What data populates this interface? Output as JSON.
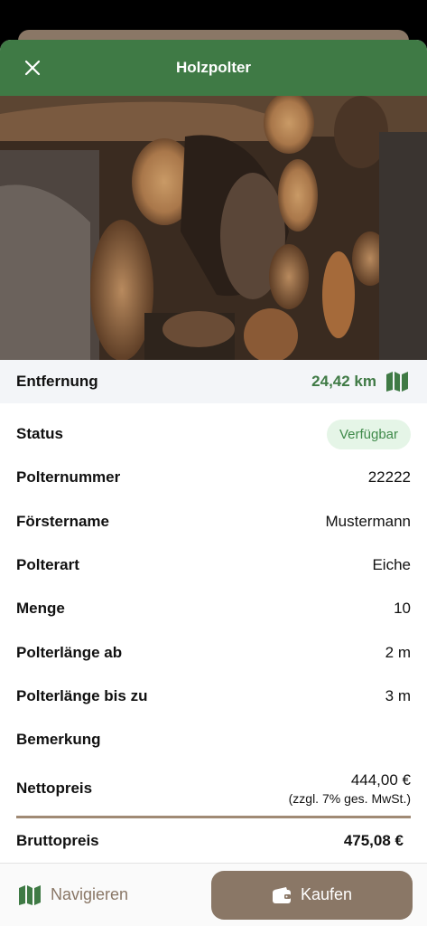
{
  "header": {
    "title": "Holzpolter",
    "close_icon": "close-icon"
  },
  "distance": {
    "label": "Entfernung",
    "value": "24,42 km",
    "icon": "map-icon",
    "color": "#3f7a45"
  },
  "details": [
    {
      "label": "Status",
      "value": "Verfügbar",
      "type": "badge"
    },
    {
      "label": "Polternummer",
      "value": "22222"
    },
    {
      "label": "Förstername",
      "value": "Mustermann"
    },
    {
      "label": "Polterart",
      "value": "Eiche"
    },
    {
      "label": "Menge",
      "value": "10"
    },
    {
      "label": "Polterlänge ab",
      "value": "2 m"
    },
    {
      "label": "Polterlänge bis zu",
      "value": "3 m"
    },
    {
      "label": "Bemerkung",
      "value": ""
    }
  ],
  "netto": {
    "label": "Nettopreis",
    "value": "444,00 €",
    "note": "(zzgl. 7% ges. MwSt.)"
  },
  "brutto": {
    "label": "Bruttopreis",
    "value": "475,08 €"
  },
  "bottom": {
    "navigate_label": "Navigieren",
    "buy_label": "Kaufen"
  },
  "colors": {
    "primary": "#3f7a45",
    "brown": "#8a7766",
    "badge_bg": "#e5f5e7"
  }
}
